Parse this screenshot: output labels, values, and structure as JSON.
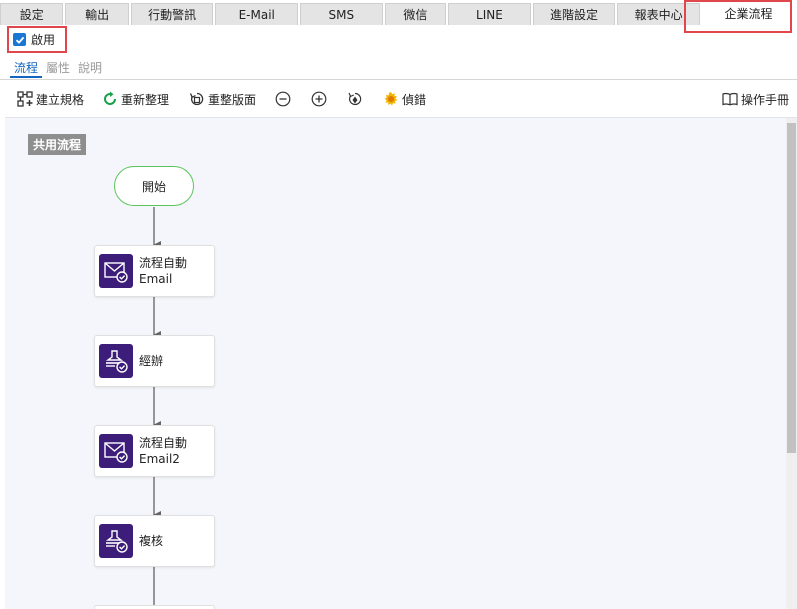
{
  "tabs": [
    {
      "label": "設定",
      "name": "tab-settings"
    },
    {
      "label": "輸出",
      "name": "tab-output"
    },
    {
      "label": "行動警訊",
      "name": "tab-mobile-alert"
    },
    {
      "label": "E-Mail",
      "name": "tab-email"
    },
    {
      "label": "SMS",
      "name": "tab-sms"
    },
    {
      "label": "微信",
      "name": "tab-wechat"
    },
    {
      "label": "LINE",
      "name": "tab-line"
    },
    {
      "label": "進階設定",
      "name": "tab-advanced"
    },
    {
      "label": "報表中心",
      "name": "tab-report-center"
    },
    {
      "label": "企業流程",
      "name": "tab-enterprise-flow"
    }
  ],
  "enable": {
    "label": "啟用",
    "checked": true
  },
  "subtabs": [
    {
      "label": "流程",
      "active": true
    },
    {
      "label": "屬性",
      "active": false
    },
    {
      "label": "說明",
      "active": false
    }
  ],
  "toolbar": {
    "create_rule": "建立規格",
    "reorganize": "重新整理",
    "reset_layout": "重整版面",
    "debug": "偵錯",
    "manual": "操作手冊"
  },
  "canvas": {
    "swimlane_label": "共用流程",
    "start_label": "開始",
    "nodes": [
      {
        "line1": "流程自動",
        "line2": "Email",
        "icon": "email-check-icon"
      },
      {
        "line1": "經辦",
        "line2": "",
        "icon": "stamp-check-icon"
      },
      {
        "line1": "流程自動",
        "line2": "Email2",
        "icon": "email-check-icon"
      },
      {
        "line1": "複核",
        "line2": "",
        "icon": "stamp-check-icon"
      }
    ]
  },
  "colors": {
    "highlight": "#e0474c",
    "accent": "#1565c0",
    "node_icon_bg": "#3d1d7a",
    "start_border": "#5cc45c"
  }
}
